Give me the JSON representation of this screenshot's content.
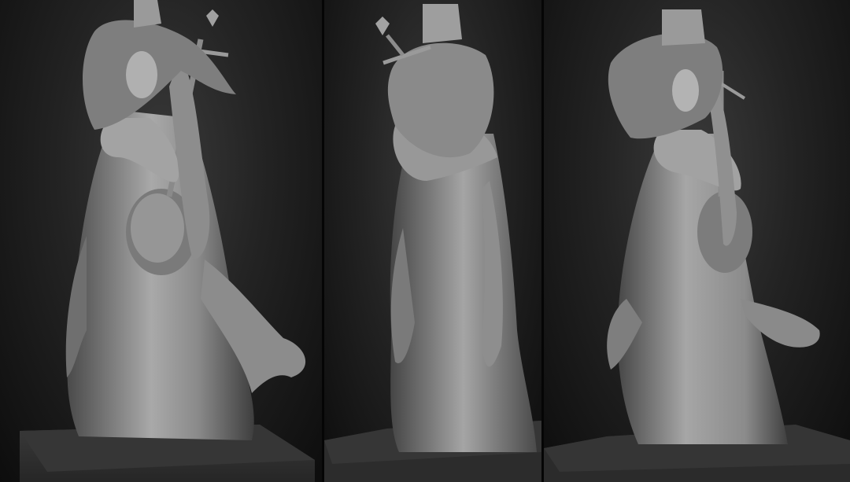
{
  "scene": {
    "background_color": "#111111",
    "sculpt_color": "#8a8a8a",
    "sculpt_highlight": "#c4c4c4",
    "sculpt_shadow": "#3a3a3a",
    "base_color": "#2f2f2f",
    "views": [
      {
        "view": "front-left"
      },
      {
        "view": "back"
      },
      {
        "view": "front-right"
      }
    ]
  }
}
